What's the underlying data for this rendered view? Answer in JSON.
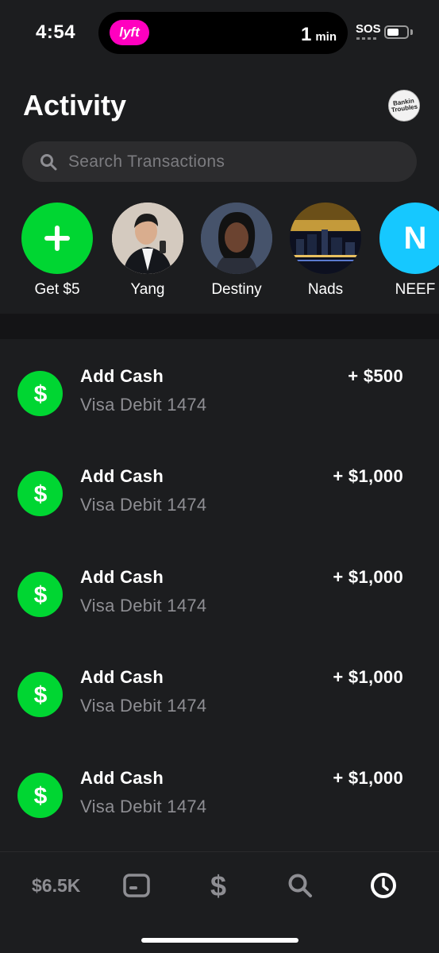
{
  "status_bar": {
    "time": "4:54",
    "live_activity_app": "lyft",
    "eta_number": "1",
    "eta_unit": "min",
    "network": "SOS",
    "battery_level": 0.6
  },
  "header": {
    "title": "Activity",
    "profile_avatar_text": "Bankin Troubles"
  },
  "search": {
    "placeholder": "Search Transactions"
  },
  "contacts": [
    {
      "name": "Get $5",
      "type": "action",
      "icon": "plus-icon"
    },
    {
      "name": "Yang",
      "type": "photo"
    },
    {
      "name": "Destiny",
      "type": "photo"
    },
    {
      "name": "Nads",
      "type": "photo"
    },
    {
      "name": "NEEF",
      "type": "initial",
      "initial": "N"
    }
  ],
  "transactions": [
    {
      "title": "Add Cash",
      "subtitle": "Visa Debit 1474",
      "amount": "+ $500"
    },
    {
      "title": "Add Cash",
      "subtitle": "Visa Debit 1474",
      "amount": "+ $1,000"
    },
    {
      "title": "Add Cash",
      "subtitle": "Visa Debit 1474",
      "amount": "+ $1,000"
    },
    {
      "title": "Add Cash",
      "subtitle": "Visa Debit 1474",
      "amount": "+ $1,000"
    },
    {
      "title": "Add Cash",
      "subtitle": "Visa Debit 1474",
      "amount": "+ $1,000"
    }
  ],
  "tabbar": {
    "balance": "$6.5K",
    "tabs": [
      "card-icon",
      "dollar-icon",
      "search-icon",
      "clock-icon"
    ],
    "active_tab": "clock-icon"
  },
  "colors": {
    "background": "#1c1d1f",
    "cash_green": "#00d632",
    "lyft_pink": "#ff00bf",
    "neef_blue": "#16c8ff",
    "muted_text": "#8e8e93"
  }
}
